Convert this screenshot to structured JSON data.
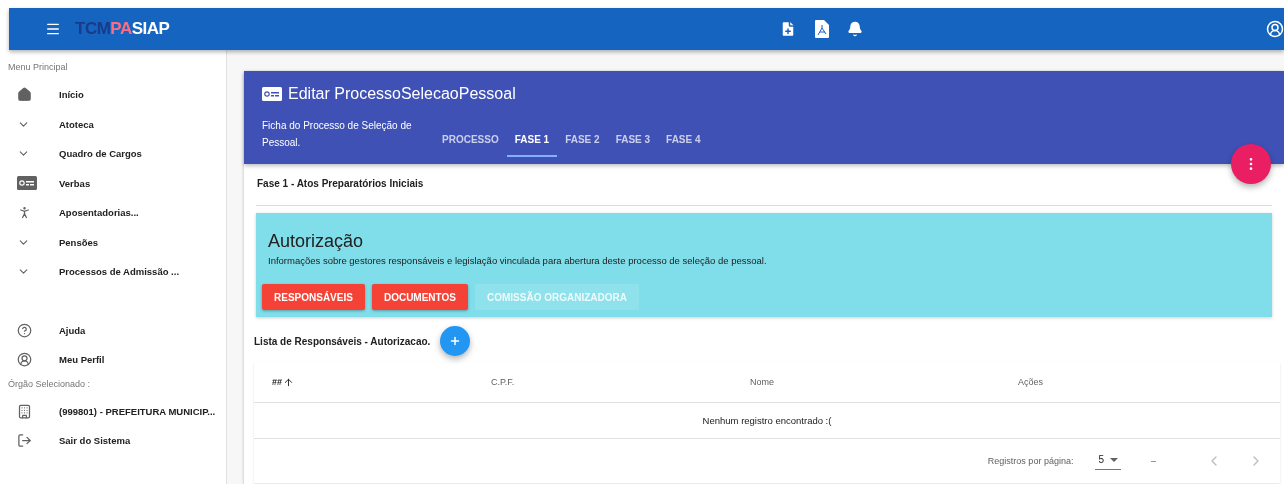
{
  "top_bar": {
    "logo": [
      {
        "text": "TCM",
        "color": "#1a3a8a"
      },
      {
        "text": "PA",
        "color": "#ff6b80"
      },
      {
        "text": "SIAP",
        "color": "#ffffff"
      }
    ],
    "actions": [
      {
        "kind": "file-plus"
      },
      {
        "kind": "file-pdf"
      },
      {
        "kind": "bell"
      }
    ]
  },
  "sidebar": {
    "sections": [
      {
        "heading": "Menu Principal",
        "items": [
          {
            "label": "Início",
            "kind": "home"
          },
          {
            "label": "Atoteca",
            "kind": "chevron"
          },
          {
            "label": "Quadro de Cargos",
            "kind": "chevron"
          },
          {
            "label": "Verbas",
            "kind": "money"
          },
          {
            "label": "Aposentadorias...",
            "kind": "walk"
          },
          {
            "label": "Pensões",
            "kind": "chevron"
          },
          {
            "label": "Processos de Admissão ...",
            "kind": "chevron"
          }
        ]
      },
      {
        "items": [
          {
            "label": "Ajuda",
            "kind": "help"
          },
          {
            "label": "Meu Perfil",
            "kind": "account"
          }
        ]
      },
      {
        "heading": "Órgão Selecionado :",
        "items": [
          {
            "label": "(999801) - PREFEITURA MUNICIP...",
            "kind": "building"
          },
          {
            "label": "Sair do Sistema",
            "kind": "logout"
          }
        ]
      }
    ]
  },
  "card": {
    "title": "Editar ProcessoSelecaoPessoal",
    "subtitle": "Ficha do Processo de Seleção de Pessoal.",
    "tabs": [
      {
        "label": "PROCESSO",
        "selected": false
      },
      {
        "label": "FASE 1",
        "selected": true
      },
      {
        "label": "FASE 2",
        "selected": false
      },
      {
        "label": "FASE 3",
        "selected": false
      },
      {
        "label": "FASE 4",
        "selected": false
      }
    ],
    "section_title": "Fase 1 - Atos Preparatórios Iniciais",
    "panel": {
      "title": "Autorização",
      "description": "Informações sobre gestores responsáveis e legislação vinculada para abertura deste processo de seleção de pessoal.",
      "buttons": [
        {
          "label": "RESPONSÁVEIS",
          "disabled": false
        },
        {
          "label": "DOCUMENTOS",
          "disabled": false
        },
        {
          "label": "COMISSÃO ORGANIZADORA",
          "disabled": true
        }
      ]
    },
    "list_title": "Lista de Responsáveis - Autorizacao.",
    "table": {
      "columns": [
        {
          "label": "##",
          "sorted": true
        },
        {
          "label": "C.P.F.",
          "sorted": false
        },
        {
          "label": "Nome",
          "sorted": false
        },
        {
          "label": "Ações",
          "sorted": false
        }
      ],
      "empty_message": "Nenhum registro encontrado :(",
      "pagination": {
        "rows_label": "Registros por página:",
        "rows_value": "5",
        "range": "–",
        "previous_disabled": true,
        "next_disabled": true
      }
    }
  }
}
